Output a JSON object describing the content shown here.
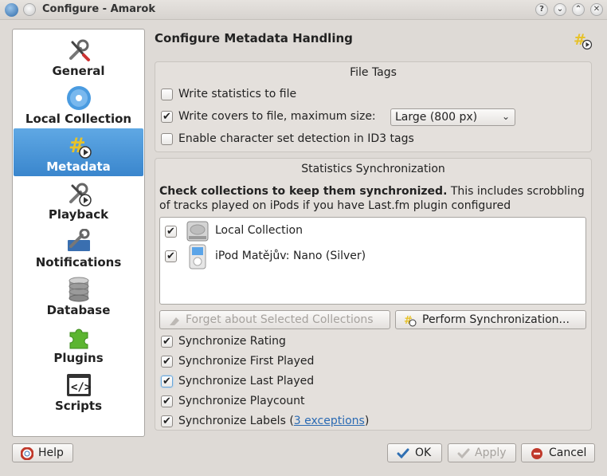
{
  "window": {
    "title": "Configure - Amarok",
    "controls": [
      "?",
      "⌄",
      "⌃",
      "✕"
    ]
  },
  "sidebar": {
    "items": [
      {
        "label": "General",
        "icon": "wrench-screwdriver-icon"
      },
      {
        "label": "Local Collection",
        "icon": "disc-icon"
      },
      {
        "label": "Metadata",
        "icon": "tag-play-icon",
        "selected": true
      },
      {
        "label": "Playback",
        "icon": "wrench-play-icon"
      },
      {
        "label": "Notifications",
        "icon": "wrench-screen-icon"
      },
      {
        "label": "Database",
        "icon": "database-icon"
      },
      {
        "label": "Plugins",
        "icon": "puzzle-icon"
      },
      {
        "label": "Scripts",
        "icon": "code-icon"
      }
    ]
  },
  "page": {
    "title": "Configure Metadata Handling",
    "icon": "metadata-icon"
  },
  "file_tags": {
    "title": "File Tags",
    "write_statistics": {
      "label": "Write statistics to file",
      "checked": false
    },
    "write_covers": {
      "label": "Write covers to file, maximum size:",
      "checked": true
    },
    "cover_size": {
      "selected": "Large (800 px)"
    },
    "charset_detection": {
      "label": "Enable character set detection in ID3 tags",
      "checked": false
    }
  },
  "stats_sync": {
    "title": "Statistics Synchronization",
    "desc_bold": "Check collections to keep them synchronized.",
    "desc_rest": " This includes scrobbling of tracks played on iPods if you have Last.fm plugin configured",
    "collections": [
      {
        "label": "Local Collection",
        "checked": true,
        "icon": "hard-drive-icon"
      },
      {
        "label": "iPod Matějův: Nano (Silver)",
        "checked": true,
        "icon": "ipod-icon"
      }
    ],
    "forget_button": "Forget about Selected Collections",
    "perform_button": "Perform Synchronization...",
    "options": [
      {
        "label": "Synchronize Rating",
        "checked": true
      },
      {
        "label": "Synchronize First Played",
        "checked": true
      },
      {
        "label": "Synchronize Last Played",
        "checked": true
      },
      {
        "label": "Synchronize Playcount",
        "checked": true
      }
    ],
    "labels_option": {
      "prefix": "Synchronize Labels (",
      "link": "3 exceptions",
      "suffix": ")",
      "checked": true
    }
  },
  "buttons": {
    "help": "Help",
    "ok": "OK",
    "apply": "Apply",
    "cancel": "Cancel"
  },
  "colors": {
    "selection": "#3a86cd",
    "link": "#2a6ab3",
    "cancel_red": "#c0392b",
    "ok_blue": "#2f6fb2"
  }
}
